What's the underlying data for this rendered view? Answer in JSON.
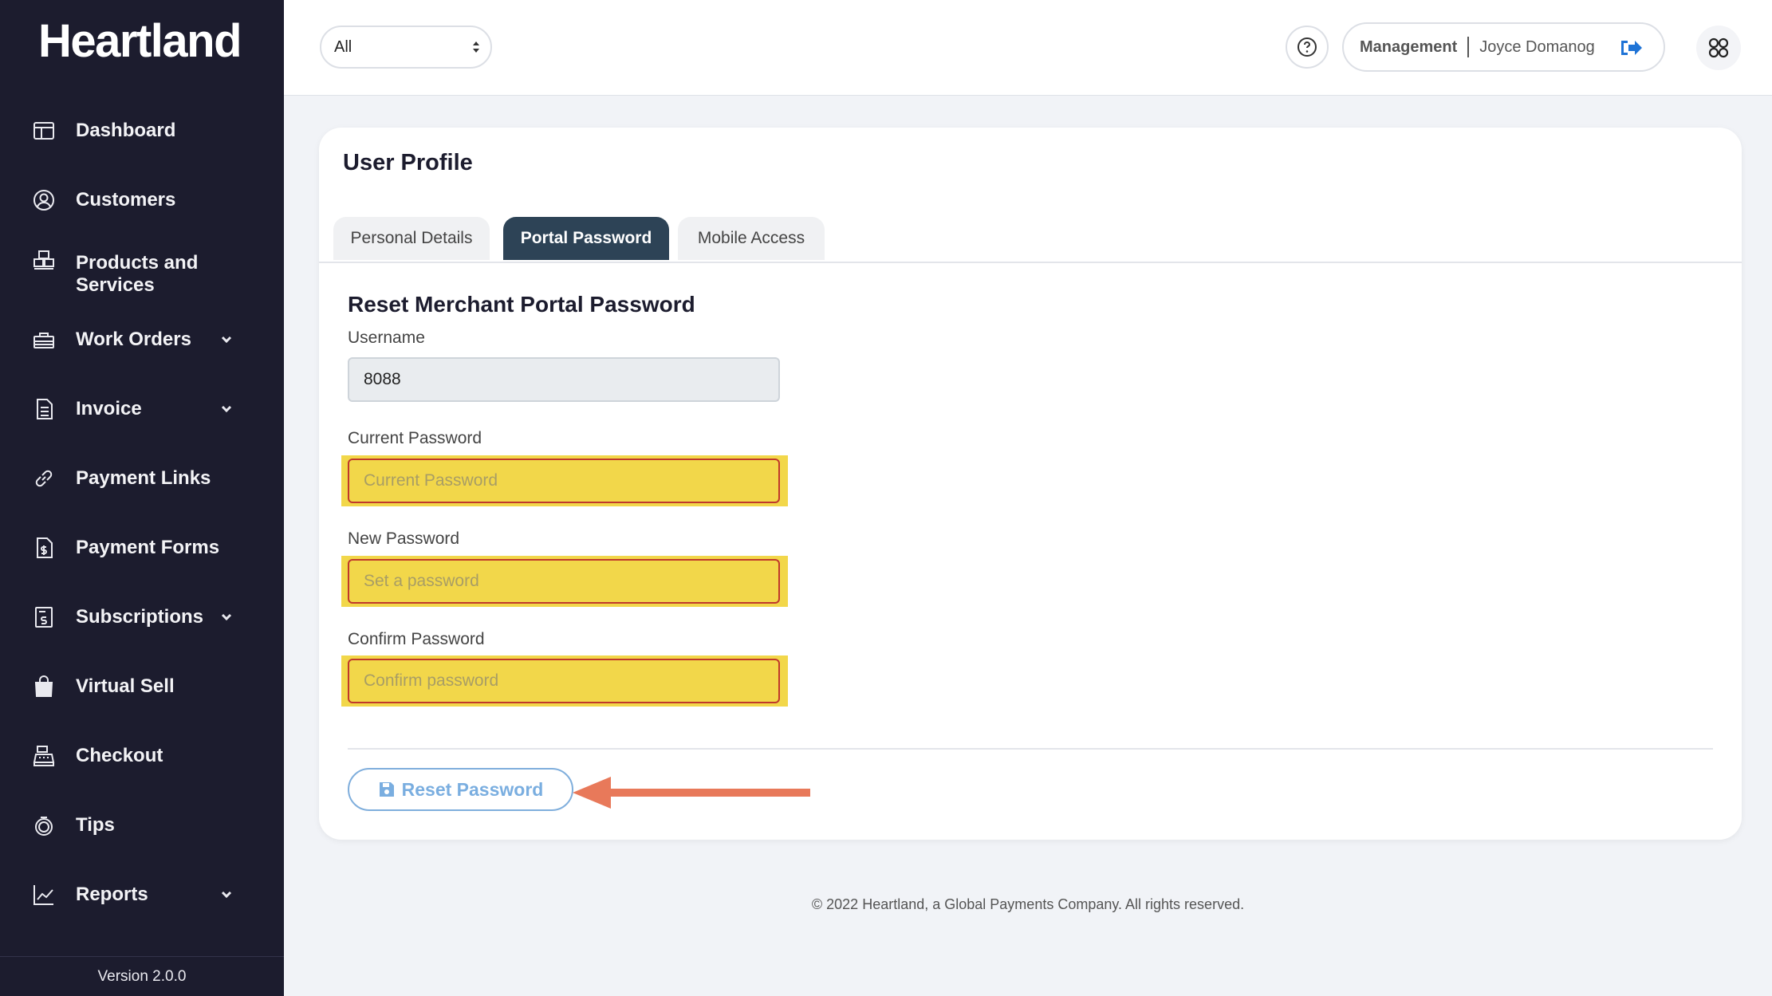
{
  "app": {
    "logo": "Heartland",
    "version": "Version 2.0.0"
  },
  "sidebar": {
    "items": [
      {
        "label": "Dashboard",
        "icon": "dashboard-icon",
        "has_chevron": false
      },
      {
        "label": "Customers",
        "icon": "user-circle-icon",
        "has_chevron": false
      },
      {
        "label": "Products and Services",
        "icon": "boxes-icon",
        "has_chevron": false
      },
      {
        "label": "Work Orders",
        "icon": "toolbox-icon",
        "has_chevron": true
      },
      {
        "label": "Invoice",
        "icon": "invoice-icon",
        "has_chevron": true
      },
      {
        "label": "Payment Links",
        "icon": "link-icon",
        "has_chevron": false
      },
      {
        "label": "Payment Forms",
        "icon": "file-dollar-icon",
        "has_chevron": false
      },
      {
        "label": "Subscriptions",
        "icon": "subscription-doc-icon",
        "has_chevron": true
      },
      {
        "label": "Virtual Sell",
        "icon": "shopping-bag-icon",
        "has_chevron": false
      },
      {
        "label": "Checkout",
        "icon": "cash-register-icon",
        "has_chevron": false
      },
      {
        "label": "Tips",
        "icon": "coin-icon",
        "has_chevron": false
      },
      {
        "label": "Reports",
        "icon": "chart-line-icon",
        "has_chevron": true
      }
    ]
  },
  "topbar": {
    "filter_value": "All",
    "role": "Management",
    "user_name": "Joyce Domanog"
  },
  "profile": {
    "title": "User Profile",
    "tabs": [
      {
        "label": "Personal Details",
        "active": false
      },
      {
        "label": "Portal Password",
        "active": true
      },
      {
        "label": "Mobile Access",
        "active": false
      }
    ],
    "section_title": "Reset Merchant Portal Password",
    "username_label": "Username",
    "username_value": "8088",
    "current_password_label": "Current Password",
    "current_password_placeholder": "Current Password",
    "new_password_label": "New Password",
    "new_password_placeholder": "Set a password",
    "confirm_password_label": "Confirm Password",
    "confirm_password_placeholder": "Confirm password",
    "reset_button_label": "Reset Password"
  },
  "footer": {
    "copyright": "© 2022 Heartland, a Global Payments Company. All rights reserved."
  },
  "colors": {
    "sidebar_bg": "#1c1c2e",
    "active_tab": "#2d4356",
    "highlight": "#f2d74a",
    "highlight_border": "#c0392b",
    "reset_button": "#7aaee0",
    "annotation_arrow": "#e8795a",
    "logout_icon": "#1e73d6"
  }
}
